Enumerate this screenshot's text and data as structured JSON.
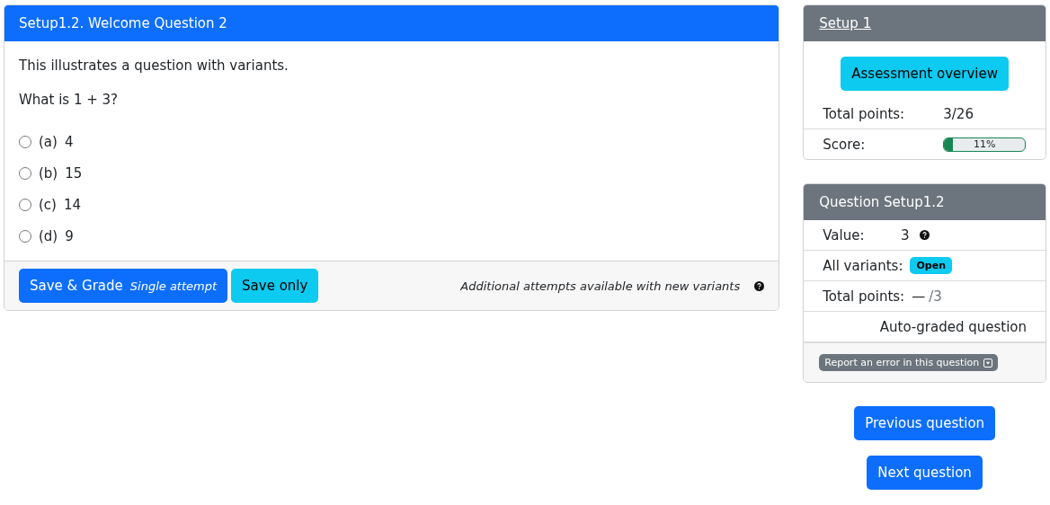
{
  "question_card": {
    "title": "Setup1.2. Welcome Question 2",
    "text": "This illustrates a question with variants.",
    "prompt": "What is 1 + 3?",
    "options": [
      {
        "label": "(a)",
        "value": "4",
        "selected": false
      },
      {
        "label": "(b)",
        "value": "15",
        "selected": false
      },
      {
        "label": "(c)",
        "value": "14",
        "selected": false
      },
      {
        "label": "(d)",
        "value": "9",
        "selected": false
      }
    ],
    "save_grade_button": {
      "label": "Save & Grade",
      "note": "Single attempt"
    },
    "save_only_button": "Save only",
    "footer_note": "Additional attempts available with new variants"
  },
  "assessment_card": {
    "title": "Setup 1",
    "overview_button": "Assessment overview",
    "total_points_label": "Total points:",
    "total_points": "3/26",
    "score_label": "Score:",
    "score": {
      "level": 0.11,
      "reading": "11%"
    }
  },
  "question_info_card": {
    "title": "Question Setup1.2",
    "value_label": "Value:",
    "value": "3",
    "variants_label": "All variants:",
    "variants_badge": "Open",
    "total_points_label": "Total points:",
    "total_points": "—",
    "total_points_max": "/3",
    "grading": "Auto-graded question",
    "report_button": "Report an error in this question"
  },
  "navigation": {
    "previous": "Previous question",
    "next": "Next question"
  }
}
